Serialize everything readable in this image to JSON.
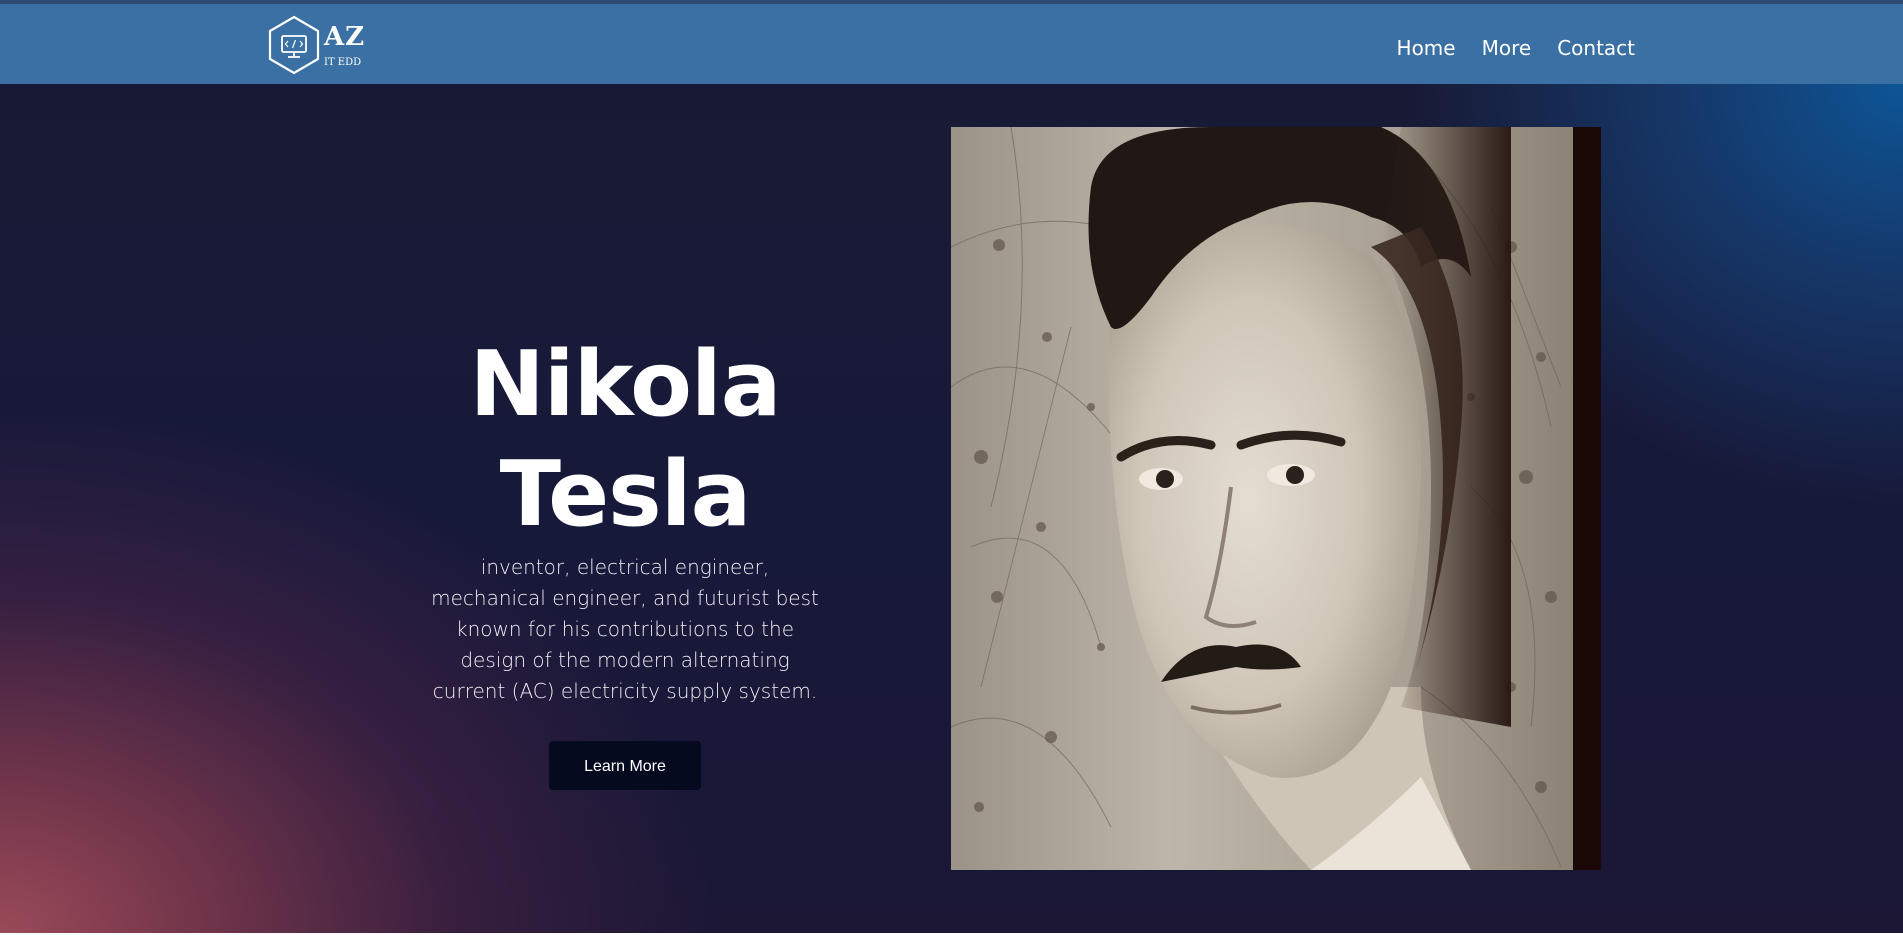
{
  "navbar": {
    "logo": {
      "mark": "AZ",
      "sub": "IT EDD",
      "icon": "code-monitor-hexagon-icon"
    },
    "links": [
      "Home",
      "More",
      "Contact"
    ]
  },
  "hero": {
    "title": "Nikola Tesla",
    "description": "inventor, electrical engineer, mechanical engineer, and futurist best known for his contributions to the design of the modern alternating current (AC) electricity supply system.",
    "button_label": "Learn More",
    "image": "nikola-tesla-portrait"
  },
  "colors": {
    "navbar": "#3a70a3",
    "button": "#050a1f",
    "hero_dark": "#17193a",
    "hero_blue": "#0d5596",
    "hero_rose": "#9a4a58"
  }
}
